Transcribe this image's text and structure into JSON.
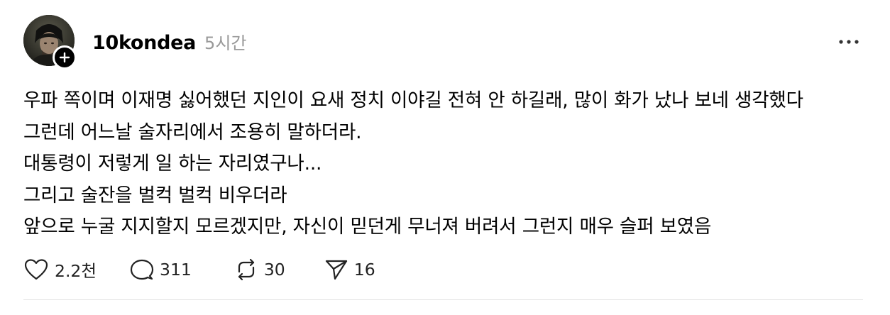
{
  "post": {
    "username": "10kondea",
    "time": "5시간",
    "body_lines": [
      "우파 쪽이며 이재명 싫어했던 지인이 요새 정치 이야길 전혀 안 하길래, 많이 화가 났나 보네 생각했다",
      "그런데 어느날 술자리에서 조용히 말하더라.",
      "대통령이 저렇게 일 하는 자리였구나...",
      "그리고 술잔을 벌컥 벌컥 비우더라",
      "앞으로 누굴 지지할지 모르겠지만, 자신이 믿던게 무너져 버려서 그런지 매우 슬퍼 보였음"
    ],
    "actions": {
      "likes": "2.2천",
      "comments": "311",
      "reposts": "30",
      "shares": "16"
    }
  },
  "icons": {
    "follow": "plus-icon",
    "more": "more-horizontal-icon",
    "like": "heart-icon",
    "comment": "comment-bubble-icon",
    "repost": "repost-icon",
    "share": "send-icon"
  },
  "colors": {
    "text": "#000000",
    "muted": "#999999",
    "action_text": "#222222",
    "divider": "#e4e4e4"
  }
}
